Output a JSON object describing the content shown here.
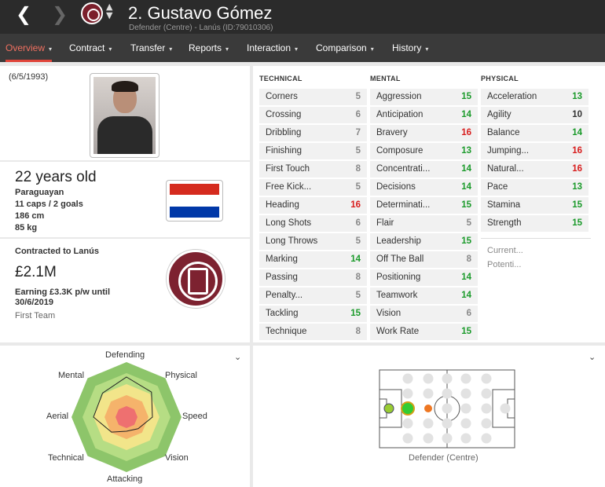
{
  "header": {
    "back_icon": "❮",
    "forward_icon": "❯",
    "updown_icon": "⌃⌄",
    "title": "2. Gustavo Gómez",
    "subtitle": "Defender (Centre) - Lanús (ID:79010306)"
  },
  "tabs": [
    {
      "label": "Overview",
      "active": true
    },
    {
      "label": "Contract"
    },
    {
      "label": "Transfer"
    },
    {
      "label": "Reports"
    },
    {
      "label": "Interaction"
    },
    {
      "label": "Comparison"
    },
    {
      "label": "History"
    }
  ],
  "profile": {
    "dob": "(6/5/1993)",
    "age": "22 years old",
    "nationality": "Paraguayan",
    "caps": "11 caps / 2 goals",
    "height": "186 cm",
    "weight": "85 kg",
    "flag_colors": [
      "#d52b1e",
      "#ffffff",
      "#0038a8"
    ]
  },
  "contract": {
    "label": "Contracted to Lanús",
    "value": "£2.1M",
    "wage": "Earning £3.3K p/w until 30/6/2019",
    "squad": "First Team"
  },
  "attributes": {
    "technical_label": "TECHNICAL",
    "mental_label": "MENTAL",
    "physical_label": "PHYSICAL",
    "technical": [
      {
        "name": "Corners",
        "value": "5"
      },
      {
        "name": "Crossing",
        "value": "6"
      },
      {
        "name": "Dribbling",
        "value": "7"
      },
      {
        "name": "Finishing",
        "value": "5"
      },
      {
        "name": "First Touch",
        "value": "8"
      },
      {
        "name": "Free Kick...",
        "value": "5"
      },
      {
        "name": "Heading",
        "value": "16"
      },
      {
        "name": "Long Shots",
        "value": "6"
      },
      {
        "name": "Long Throws",
        "value": "5"
      },
      {
        "name": "Marking",
        "value": "14"
      },
      {
        "name": "Passing",
        "value": "8"
      },
      {
        "name": "Penalty...",
        "value": "5"
      },
      {
        "name": "Tackling",
        "value": "15"
      },
      {
        "name": "Technique",
        "value": "8"
      }
    ],
    "mental": [
      {
        "name": "Aggression",
        "value": "15"
      },
      {
        "name": "Anticipation",
        "value": "14"
      },
      {
        "name": "Bravery",
        "value": "16"
      },
      {
        "name": "Composure",
        "value": "13"
      },
      {
        "name": "Concentrati...",
        "value": "14"
      },
      {
        "name": "Decisions",
        "value": "14"
      },
      {
        "name": "Determinati...",
        "value": "15"
      },
      {
        "name": "Flair",
        "value": "5"
      },
      {
        "name": "Leadership",
        "value": "15"
      },
      {
        "name": "Off The Ball",
        "value": "8"
      },
      {
        "name": "Positioning",
        "value": "14"
      },
      {
        "name": "Teamwork",
        "value": "14"
      },
      {
        "name": "Vision",
        "value": "6"
      },
      {
        "name": "Work Rate",
        "value": "15"
      }
    ],
    "physical": [
      {
        "name": "Acceleration",
        "value": "13"
      },
      {
        "name": "Agility",
        "value": "10"
      },
      {
        "name": "Balance",
        "value": "14"
      },
      {
        "name": "Jumping...",
        "value": "16"
      },
      {
        "name": "Natural...",
        "value": "16"
      },
      {
        "name": "Pace",
        "value": "13"
      },
      {
        "name": "Stamina",
        "value": "15"
      },
      {
        "name": "Strength",
        "value": "15"
      }
    ],
    "current_label": "Current...",
    "potential_label": "Potenti..."
  },
  "radar": {
    "toggle_icon": "⌄",
    "labels": {
      "defending": "Defending",
      "physical": "Physical",
      "speed": "Speed",
      "vision": "Vision",
      "attacking": "Attacking",
      "technical": "Technical",
      "aerial": "Aerial",
      "mental": "Mental"
    },
    "order": [
      "Defending",
      "Physical",
      "Speed",
      "Vision",
      "Attacking",
      "Technical",
      "Aerial",
      "Mental"
    ],
    "values": [
      0.85,
      0.75,
      0.55,
      0.35,
      0.3,
      0.45,
      0.7,
      0.72
    ]
  },
  "pitch": {
    "toggle_icon": "⌄",
    "position_label": "Defender (Centre)",
    "colors": {
      "natural": "#33cc33",
      "accomplished": "#99cc33",
      "unconvincing": "#ee7722",
      "none": "#e2e2e2"
    }
  },
  "colors": {
    "green": "#1a9a2a",
    "red": "#d81d1d",
    "grey": "#888888",
    "dark": "#333333"
  }
}
